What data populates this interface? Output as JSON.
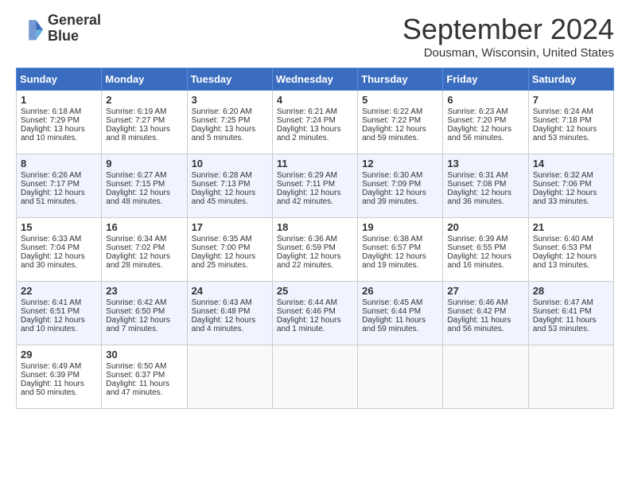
{
  "header": {
    "logo_line1": "General",
    "logo_line2": "Blue",
    "month_title": "September 2024",
    "location": "Dousman, Wisconsin, United States"
  },
  "days_of_week": [
    "Sunday",
    "Monday",
    "Tuesday",
    "Wednesday",
    "Thursday",
    "Friday",
    "Saturday"
  ],
  "weeks": [
    [
      {
        "num": "1",
        "sunrise": "6:18 AM",
        "sunset": "7:29 PM",
        "daylight": "13 hours and 10 minutes."
      },
      {
        "num": "2",
        "sunrise": "6:19 AM",
        "sunset": "7:27 PM",
        "daylight": "13 hours and 8 minutes."
      },
      {
        "num": "3",
        "sunrise": "6:20 AM",
        "sunset": "7:25 PM",
        "daylight": "13 hours and 5 minutes."
      },
      {
        "num": "4",
        "sunrise": "6:21 AM",
        "sunset": "7:24 PM",
        "daylight": "13 hours and 2 minutes."
      },
      {
        "num": "5",
        "sunrise": "6:22 AM",
        "sunset": "7:22 PM",
        "daylight": "12 hours and 59 minutes."
      },
      {
        "num": "6",
        "sunrise": "6:23 AM",
        "sunset": "7:20 PM",
        "daylight": "12 hours and 56 minutes."
      },
      {
        "num": "7",
        "sunrise": "6:24 AM",
        "sunset": "7:18 PM",
        "daylight": "12 hours and 53 minutes."
      }
    ],
    [
      {
        "num": "8",
        "sunrise": "6:26 AM",
        "sunset": "7:17 PM",
        "daylight": "12 hours and 51 minutes."
      },
      {
        "num": "9",
        "sunrise": "6:27 AM",
        "sunset": "7:15 PM",
        "daylight": "12 hours and 48 minutes."
      },
      {
        "num": "10",
        "sunrise": "6:28 AM",
        "sunset": "7:13 PM",
        "daylight": "12 hours and 45 minutes."
      },
      {
        "num": "11",
        "sunrise": "6:29 AM",
        "sunset": "7:11 PM",
        "daylight": "12 hours and 42 minutes."
      },
      {
        "num": "12",
        "sunrise": "6:30 AM",
        "sunset": "7:09 PM",
        "daylight": "12 hours and 39 minutes."
      },
      {
        "num": "13",
        "sunrise": "6:31 AM",
        "sunset": "7:08 PM",
        "daylight": "12 hours and 36 minutes."
      },
      {
        "num": "14",
        "sunrise": "6:32 AM",
        "sunset": "7:06 PM",
        "daylight": "12 hours and 33 minutes."
      }
    ],
    [
      {
        "num": "15",
        "sunrise": "6:33 AM",
        "sunset": "7:04 PM",
        "daylight": "12 hours and 30 minutes."
      },
      {
        "num": "16",
        "sunrise": "6:34 AM",
        "sunset": "7:02 PM",
        "daylight": "12 hours and 28 minutes."
      },
      {
        "num": "17",
        "sunrise": "6:35 AM",
        "sunset": "7:00 PM",
        "daylight": "12 hours and 25 minutes."
      },
      {
        "num": "18",
        "sunrise": "6:36 AM",
        "sunset": "6:59 PM",
        "daylight": "12 hours and 22 minutes."
      },
      {
        "num": "19",
        "sunrise": "6:38 AM",
        "sunset": "6:57 PM",
        "daylight": "12 hours and 19 minutes."
      },
      {
        "num": "20",
        "sunrise": "6:39 AM",
        "sunset": "6:55 PM",
        "daylight": "12 hours and 16 minutes."
      },
      {
        "num": "21",
        "sunrise": "6:40 AM",
        "sunset": "6:53 PM",
        "daylight": "12 hours and 13 minutes."
      }
    ],
    [
      {
        "num": "22",
        "sunrise": "6:41 AM",
        "sunset": "6:51 PM",
        "daylight": "12 hours and 10 minutes."
      },
      {
        "num": "23",
        "sunrise": "6:42 AM",
        "sunset": "6:50 PM",
        "daylight": "12 hours and 7 minutes."
      },
      {
        "num": "24",
        "sunrise": "6:43 AM",
        "sunset": "6:48 PM",
        "daylight": "12 hours and 4 minutes."
      },
      {
        "num": "25",
        "sunrise": "6:44 AM",
        "sunset": "6:46 PM",
        "daylight": "12 hours and 1 minute."
      },
      {
        "num": "26",
        "sunrise": "6:45 AM",
        "sunset": "6:44 PM",
        "daylight": "11 hours and 59 minutes."
      },
      {
        "num": "27",
        "sunrise": "6:46 AM",
        "sunset": "6:42 PM",
        "daylight": "11 hours and 56 minutes."
      },
      {
        "num": "28",
        "sunrise": "6:47 AM",
        "sunset": "6:41 PM",
        "daylight": "11 hours and 53 minutes."
      }
    ],
    [
      {
        "num": "29",
        "sunrise": "6:49 AM",
        "sunset": "6:39 PM",
        "daylight": "11 hours and 50 minutes."
      },
      {
        "num": "30",
        "sunrise": "6:50 AM",
        "sunset": "6:37 PM",
        "daylight": "11 hours and 47 minutes."
      },
      null,
      null,
      null,
      null,
      null
    ]
  ]
}
